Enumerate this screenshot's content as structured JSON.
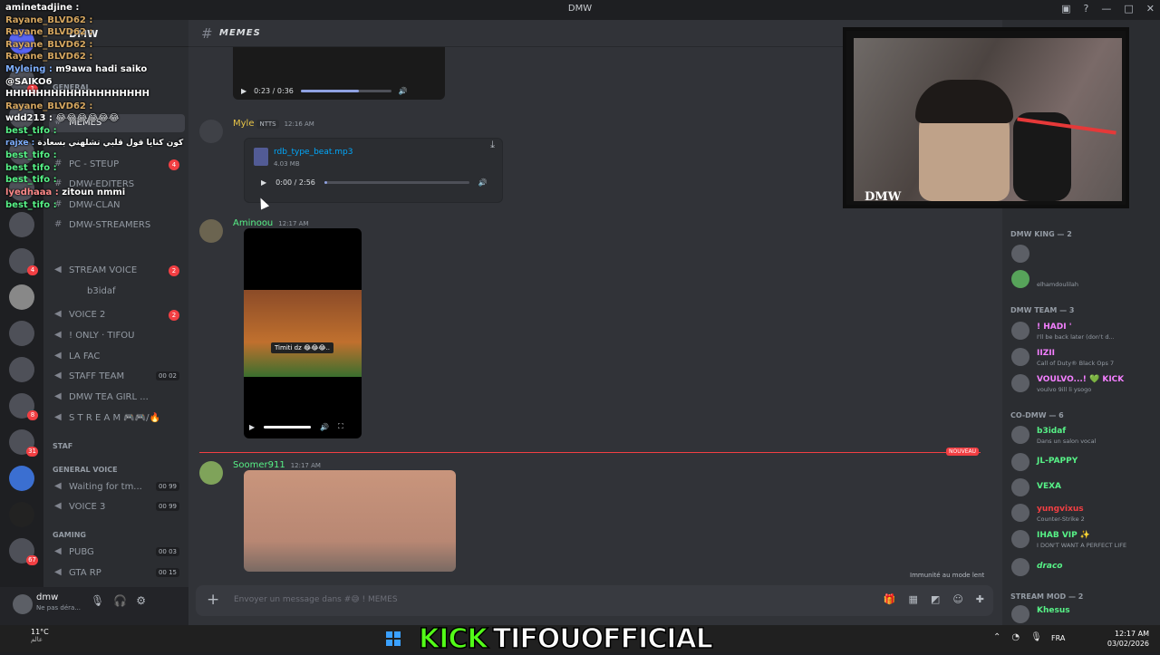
{
  "window": {
    "title": "DMW"
  },
  "server": {
    "name": "DMW"
  },
  "channel_header": {
    "name": "MEMES"
  },
  "channels": [
    {
      "label": "GENERAL",
      "type": "category"
    },
    {
      "label": "MEMES",
      "active": true
    },
    {
      "label": "PC - STEUP",
      "badge": "4"
    },
    {
      "label": "DMW-EDITERS"
    },
    {
      "label": "DMW-CLAN"
    },
    {
      "label": "DMW-STREAMERS"
    },
    {
      "label": "STREAM VOICE",
      "badge": "2"
    },
    {
      "label": "b3idaf"
    },
    {
      "label": "VOICE 2",
      "badge": "2"
    },
    {
      "label": "! ONLY · TIFOU"
    },
    {
      "label": "LA FAC"
    },
    {
      "label": "STAFF TEAM",
      "count": "00 02"
    },
    {
      "label": "DMW TEA GIRL ..."
    },
    {
      "label": "S T R E A M 🎮🎮/🔥"
    },
    {
      "label": "STAF",
      "type": "category"
    },
    {
      "label": "GENERAL VOICE",
      "type": "category"
    },
    {
      "label": "Waiting for tm...",
      "count": "00 99"
    },
    {
      "label": "VOICE 3",
      "count": "00 99"
    },
    {
      "label": "GAMING",
      "type": "category"
    },
    {
      "label": "PUBG",
      "count": "00 03"
    },
    {
      "label": "GTA RP",
      "count": "00 15"
    }
  ],
  "user_panel": {
    "name": "dmw",
    "status": "Ne pas déra..."
  },
  "messages": [
    {
      "player_time": "0:23 / 0:36"
    },
    {
      "author": "Myle",
      "tag": "NTTS",
      "time": "12:16 AM",
      "file": "rdb_type_beat.mp3",
      "size": "4.03 MB",
      "player_time": "0:00 / 2:56"
    },
    {
      "author": "Aminoou",
      "time": "12:17 AM",
      "video_caption": "Timiti dz 😂😂😂.."
    },
    {
      "author": "Soomer911",
      "time": "12:17 AM"
    }
  ],
  "new_label": "NOUVEAU",
  "slowmode": "Immunité au mode lent",
  "composer": {
    "placeholder": "Envoyer un message dans #😅 ! MEMES"
  },
  "member_groups": [
    {
      "title": "DMW KING — 2"
    },
    {
      "title": "DMW TEAM — 3"
    },
    {
      "title": "CO-DMW — 6"
    },
    {
      "title": "STREAM MOD — 2"
    }
  ],
  "members": [
    {
      "name": "",
      "status": "",
      "color": "#dbdee1"
    },
    {
      "name": "",
      "status": "elhamdoulilah",
      "color": "#dbdee1"
    },
    {
      "name": "! HADI '",
      "status": "I'll be back later (don't d...",
      "color": "#f47fff"
    },
    {
      "name": "IIZII",
      "status": "Call of Duty® Black Ops 7",
      "color": "#f47fff"
    },
    {
      "name": "VOULVO...! 💚 KICK",
      "status": "voulvo 9ill li ysogo",
      "color": "#f47fff"
    },
    {
      "name": "b3idaf",
      "status": "Dans un salon vocal",
      "color": "#57f287"
    },
    {
      "name": "JL-PAPPY",
      "status": "",
      "color": "#57f287"
    },
    {
      "name": "VEXA",
      "status": "",
      "color": "#57f287"
    },
    {
      "name": "yungvixus",
      "status": "Counter-Strike 2",
      "color": "#f23f43"
    },
    {
      "name": "IHAB VIP ✨",
      "status": "I DON'T WANT A PERFECT LIFE",
      "color": "#57f287"
    },
    {
      "name": "draco",
      "status": "",
      "color": "#57f287"
    },
    {
      "name": "Khesus",
      "status": "",
      "color": "#57f287"
    }
  ],
  "stream_overlay": {
    "webcam_logo": "DMW",
    "kick_word": "KICK",
    "channel_word": "TIFOUOFFICIAL",
    "chat": [
      {
        "user": "aminetadjine :",
        "msg": "",
        "color": "#ffffff"
      },
      {
        "user": "Rayane_BLVD62 :",
        "msg": "",
        "color": "#d6a760"
      },
      {
        "user": "Rayane_BLVD62 :",
        "msg": "",
        "color": "#d6a760"
      },
      {
        "user": "Rayane_BLVD62 :",
        "msg": "",
        "color": "#d6a760"
      },
      {
        "user": "Rayane_BLVD62 :",
        "msg": "",
        "color": "#d6a760"
      },
      {
        "user": "Myleing :",
        "msg": "m9awa hadi saiko @SAIKO6 HHHHHHHHHHHHHHHHHHH",
        "color": "#7fb0ff"
      },
      {
        "user": "Rayane_BLVD62 :",
        "msg": "",
        "color": "#d6a760"
      },
      {
        "user": "wdd213 :",
        "msg": "😂😂😂😂😂😂",
        "color": "#ffffff"
      },
      {
        "user": "best_tifo :",
        "msg": "",
        "color": "#57f287"
      },
      {
        "user": "rajxe :",
        "msg": "كون كنايا قول قلبي تشلهني بسعادة",
        "color": "#7fb0ff"
      },
      {
        "user": "best_tifo :",
        "msg": "",
        "color": "#57f287"
      },
      {
        "user": "best_tifo :",
        "msg": "",
        "color": "#57f287"
      },
      {
        "user": "best_tifo :",
        "msg": "",
        "color": "#57f287"
      },
      {
        "user": "lyedhaaa :",
        "msg": "zitoun nmmi",
        "color": "#ff8a8a"
      },
      {
        "user": "best_tifo :",
        "msg": "",
        "color": "#57f287"
      }
    ]
  },
  "taskbar": {
    "temp": "11°C",
    "weather": "عالم",
    "lang": "FRA",
    "time": "12:17 AM",
    "date": "03/02/2026"
  }
}
